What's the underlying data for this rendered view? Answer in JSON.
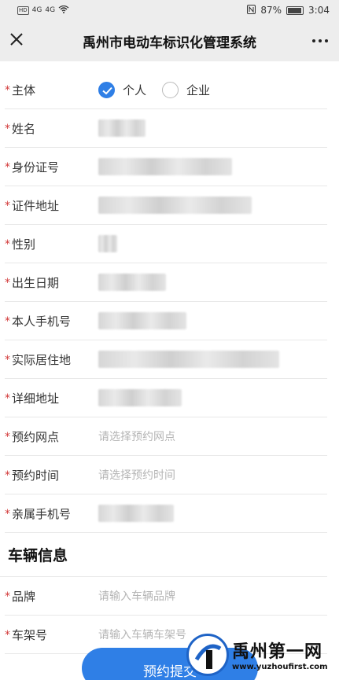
{
  "status_bar": {
    "left": [
      "HD",
      "4G",
      "4G"
    ],
    "battery": "87%",
    "time": "3:04"
  },
  "header": {
    "title": "禹州市电动车标识化管理系统",
    "close_icon": "close-icon",
    "more_icon": "more-dots-icon"
  },
  "form": {
    "subject": {
      "label": "主体",
      "options": [
        "个人",
        "企业"
      ],
      "selected": "个人"
    },
    "name": {
      "label": "姓名"
    },
    "id_number": {
      "label": "身份证号"
    },
    "id_address": {
      "label": "证件地址"
    },
    "gender": {
      "label": "性别"
    },
    "birth_date": {
      "label": "出生日期"
    },
    "phone": {
      "label": "本人手机号"
    },
    "residence": {
      "label": "实际居住地"
    },
    "detail_address": {
      "label": "详细地址"
    },
    "appointment_site": {
      "label": "预约网点",
      "placeholder": "请选择预约网点"
    },
    "appointment_time": {
      "label": "预约时间",
      "placeholder": "请选择预约时间"
    },
    "relative_phone": {
      "label": "亲属手机号"
    }
  },
  "vehicle_section": {
    "title": "车辆信息",
    "brand": {
      "label": "品牌",
      "placeholder": "请输入车辆品牌"
    },
    "frame": {
      "label": "车架号",
      "placeholder": "请输入车辆车架号"
    }
  },
  "submit_label": "预约提交",
  "watermark": {
    "name": "禹州第一网",
    "url": "www.yuzhoufirst.com"
  },
  "colors": {
    "accent": "#2f7fe6",
    "required": "#d23a3a",
    "header_bg": "#ededed"
  }
}
